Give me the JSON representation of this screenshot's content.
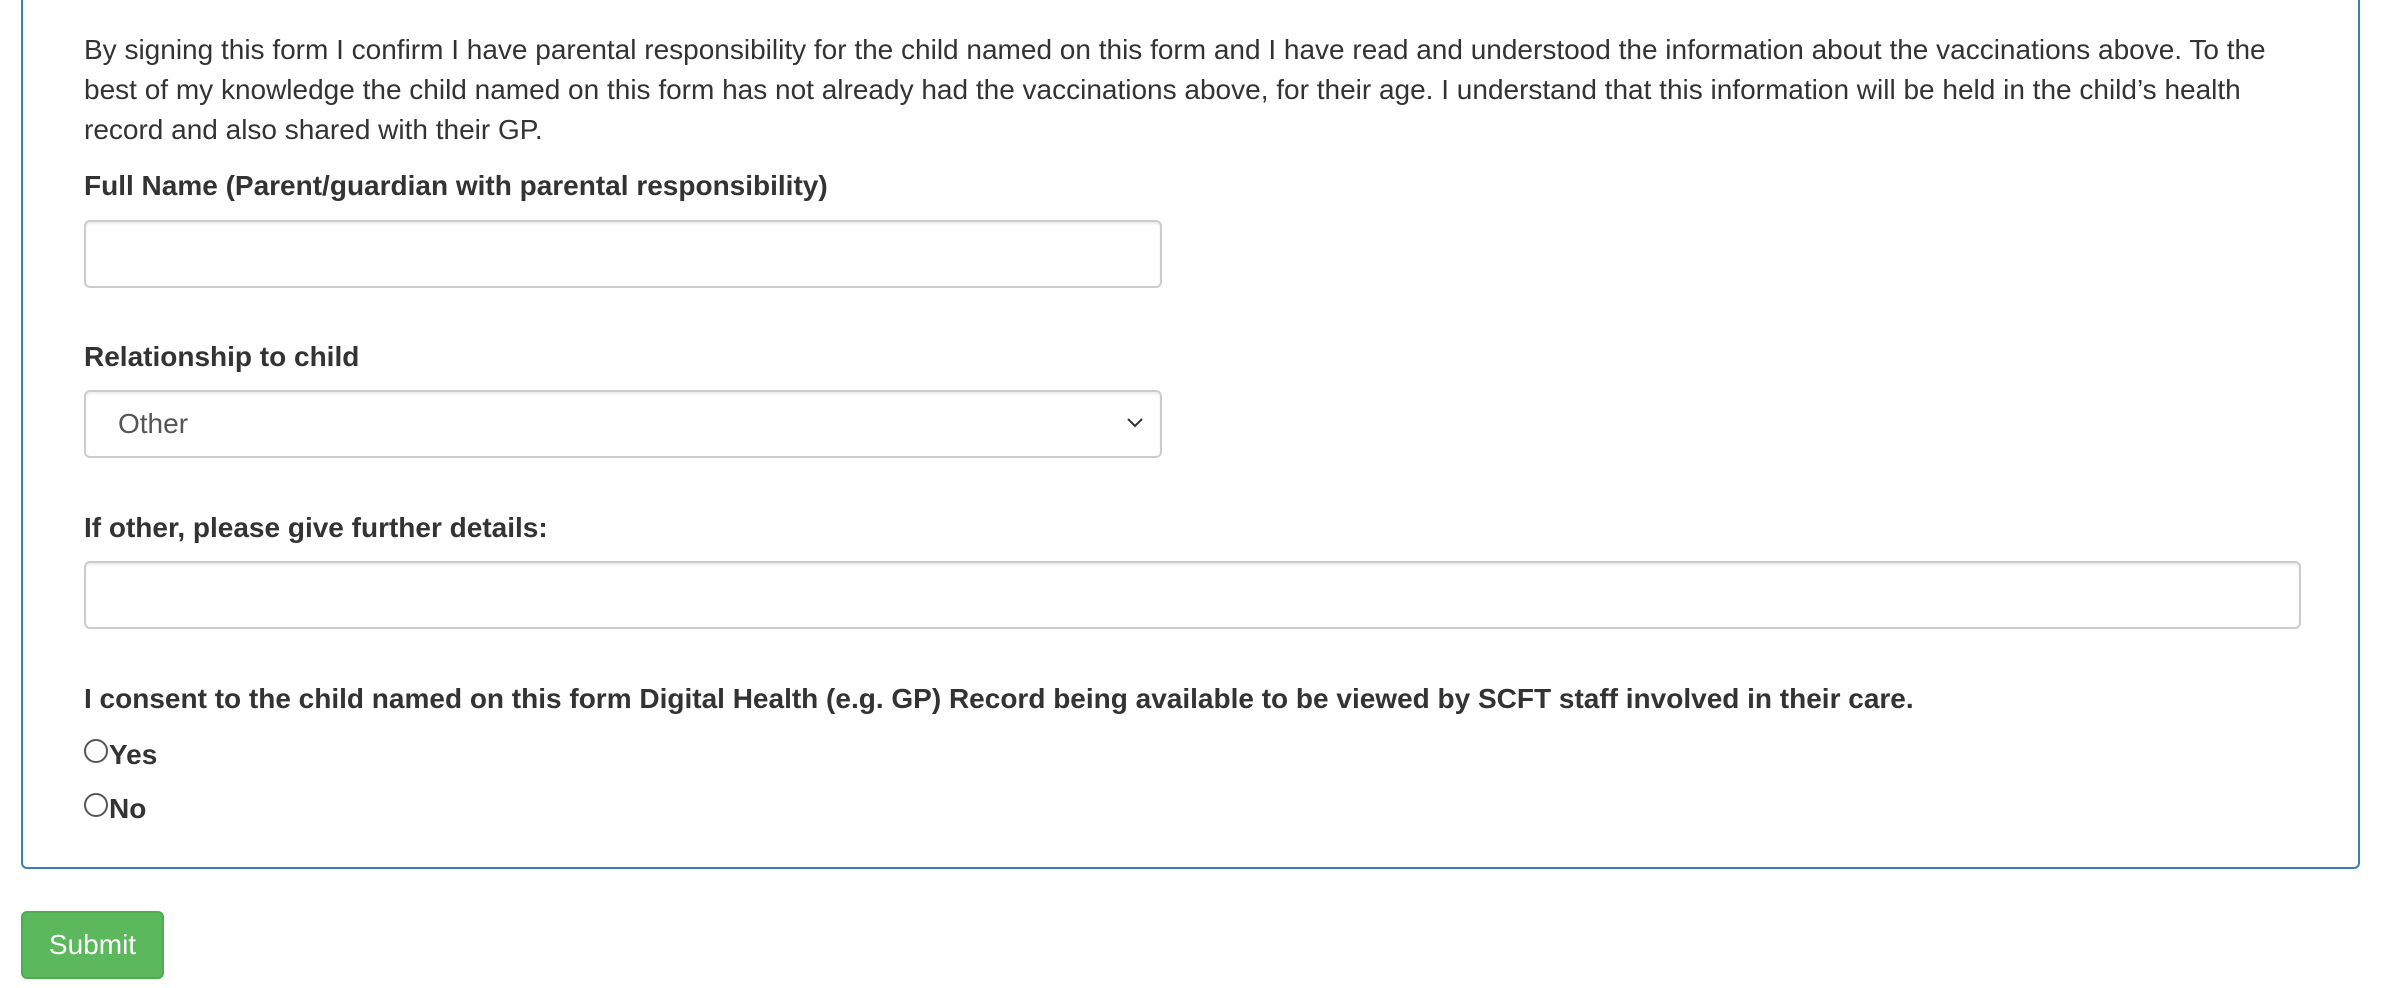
{
  "declaration": {
    "text": "By signing this form I confirm I have parental responsibility for the child named on this form and I have read and understood the information about the vaccinations above. To the best of my knowledge the child named on this form has not already had the vaccinations above, for their age. I understand that this information will be held in the child’s health record and also shared with their GP."
  },
  "full_name": {
    "label": "Full Name (Parent/guardian with parental responsibility)",
    "value": "",
    "placeholder": ""
  },
  "relationship": {
    "label": "Relationship to child",
    "selected": "Other",
    "icon": "chevron-down-icon"
  },
  "other_details": {
    "label": "If other, please give further details:",
    "value": "",
    "placeholder": ""
  },
  "consent": {
    "question": "I consent to the child named on this form Digital Health (e.g. GP) Record being available to be viewed by SCFT staff involved in their care.",
    "options": [
      {
        "label": "Yes",
        "checked": false
      },
      {
        "label": "No",
        "checked": false
      }
    ]
  },
  "actions": {
    "submit_label": "Submit"
  },
  "colors": {
    "panel_border": "#3a7fb6",
    "submit_background": "#5cb85c",
    "input_border": "#cccccc",
    "text": "#333333"
  }
}
